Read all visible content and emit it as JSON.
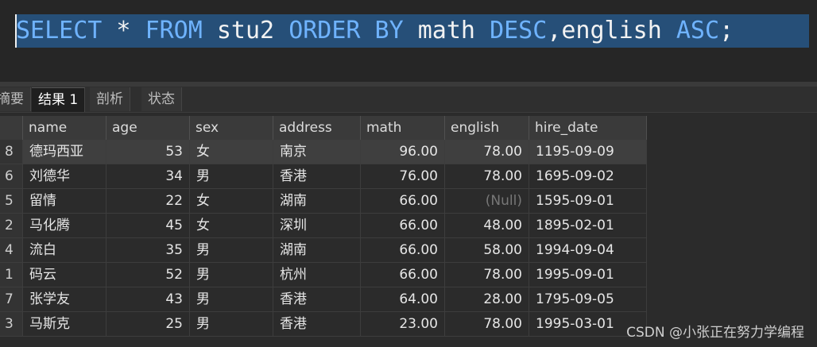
{
  "editor": {
    "sql_tokens": [
      {
        "t": "SELECT",
        "k": "kw"
      },
      {
        "t": " * ",
        "k": "tx"
      },
      {
        "t": "FROM",
        "k": "kw"
      },
      {
        "t": " stu2 ",
        "k": "tx"
      },
      {
        "t": "ORDER BY",
        "k": "kw"
      },
      {
        "t": " math ",
        "k": "tx"
      },
      {
        "t": "DESC",
        "k": "kw"
      },
      {
        "t": ",english ",
        "k": "tx"
      },
      {
        "t": "ASC",
        "k": "kw"
      },
      {
        "t": ";",
        "k": "tx"
      }
    ]
  },
  "tabs": [
    {
      "label": "摘要",
      "active": false
    },
    {
      "label": "结果 1",
      "active": true
    },
    {
      "label": "剖析",
      "active": false
    },
    {
      "label": "状态",
      "active": false
    }
  ],
  "table": {
    "columns": [
      "name",
      "age",
      "sex",
      "address",
      "math",
      "english",
      "hire_date"
    ],
    "null_label": "(Null)",
    "rows": [
      {
        "rn": "8",
        "name": "德玛西亚",
        "age": "53",
        "sex": "女",
        "address": "南京",
        "math": "96.00",
        "english": "78.00",
        "hire_date": "1195-09-09"
      },
      {
        "rn": "6",
        "name": "刘德华",
        "age": "34",
        "sex": "男",
        "address": "香港",
        "math": "76.00",
        "english": "78.00",
        "hire_date": "1695-09-02"
      },
      {
        "rn": "5",
        "name": "留情",
        "age": "22",
        "sex": "女",
        "address": "湖南",
        "math": "66.00",
        "english": null,
        "hire_date": "1595-09-01"
      },
      {
        "rn": "2",
        "name": "马化腾",
        "age": "45",
        "sex": "女",
        "address": "深圳",
        "math": "66.00",
        "english": "48.00",
        "hire_date": "1895-02-01"
      },
      {
        "rn": "4",
        "name": "流白",
        "age": "35",
        "sex": "男",
        "address": "湖南",
        "math": "66.00",
        "english": "58.00",
        "hire_date": "1994-09-04"
      },
      {
        "rn": "1",
        "name": "码云",
        "age": "52",
        "sex": "男",
        "address": "杭州",
        "math": "66.00",
        "english": "78.00",
        "hire_date": "1995-09-01"
      },
      {
        "rn": "7",
        "name": "张学友",
        "age": "43",
        "sex": "男",
        "address": "香港",
        "math": "64.00",
        "english": "28.00",
        "hire_date": "1795-09-05"
      },
      {
        "rn": "3",
        "name": "马斯克",
        "age": "25",
        "sex": "男",
        "address": "香港",
        "math": "23.00",
        "english": "78.00",
        "hire_date": "1995-03-01"
      }
    ]
  },
  "watermark": "CSDN @小张正在努力学编程"
}
